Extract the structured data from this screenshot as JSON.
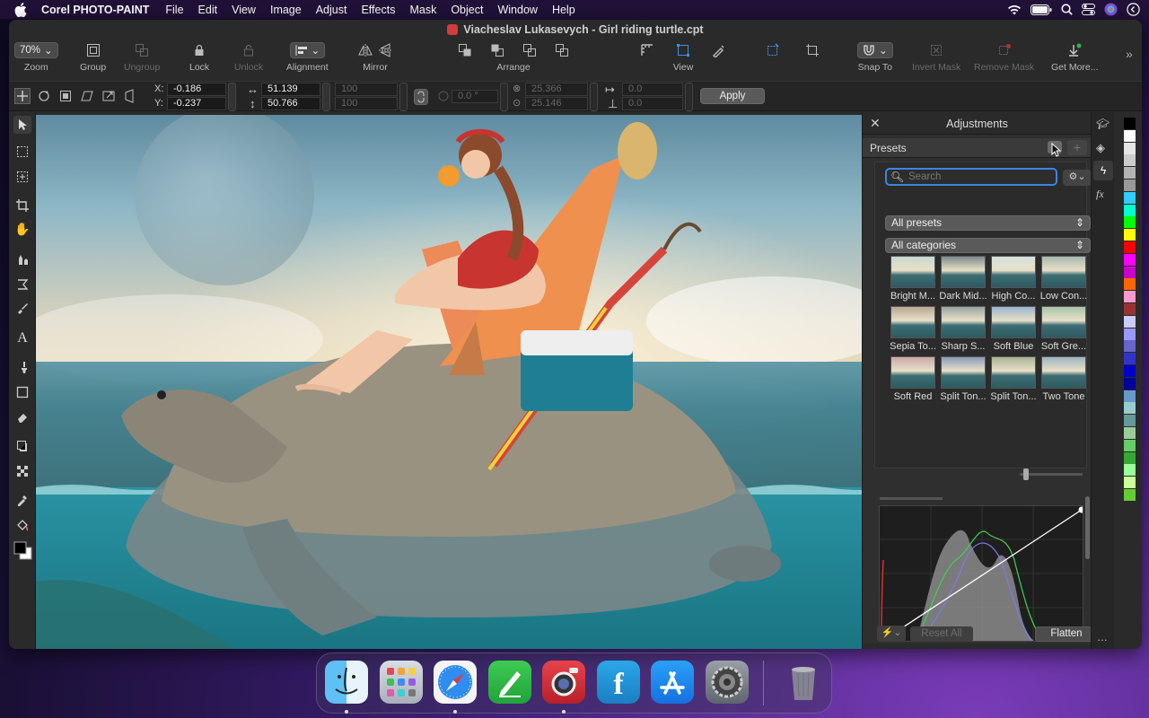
{
  "menubar": {
    "app_name": "Corel PHOTO-PAINT",
    "items": [
      "File",
      "Edit",
      "View",
      "Image",
      "Adjust",
      "Effects",
      "Mask",
      "Object",
      "Window",
      "Help"
    ]
  },
  "window": {
    "title": "Viacheslav Lukasevych - Girl riding turtle.cpt"
  },
  "toolbar": {
    "zoom_value": "70%",
    "zoom": "Zoom",
    "group": "Group",
    "ungroup": "Ungroup",
    "lock": "Lock",
    "unlock": "Unlock",
    "alignment": "Alignment",
    "mirror": "Mirror",
    "arrange": "Arrange",
    "view": "View",
    "snap_to": "Snap To",
    "invert_mask": "Invert Mask",
    "remove_mask": "Remove Mask",
    "get_more": "Get More..."
  },
  "propbar": {
    "x_label": "X:",
    "x_value": "-0.186",
    "y_label": "Y:",
    "y_value": "-0.237",
    "width_value": "51.139",
    "height_value": "50.766",
    "scale_w": "100",
    "scale_h": "100",
    "angle": "0.0 °",
    "rot_x": "25.366",
    "rot_y": "25.146",
    "skew_h": "0.0",
    "skew_v": "0.0",
    "apply": "Apply"
  },
  "docker": {
    "title": "Adjustments",
    "presets_label": "Presets",
    "search_placeholder": "Search",
    "filter1": "All presets",
    "filter2": "All categories",
    "presets": [
      "Bright M...",
      "Dark Mid...",
      "High Co...",
      "Low Con...",
      "Sepia To...",
      "Sharp S...",
      "Soft Blue",
      "Soft Gre...",
      "Soft Red",
      "Split Ton...",
      "Split Ton...",
      "Two Tone"
    ],
    "reset_all": "Reset All",
    "flatten": "Flatten"
  },
  "palette_colors": [
    "#000000",
    "#ffffff",
    "#e6e6e6",
    "#cccccc",
    "#b3b3b3",
    "#999999",
    "#33ccff",
    "#00ffcc",
    "#00ff00",
    "#ffff00",
    "#ff0000",
    "#ff00ff",
    "#cc00cc",
    "#ff6600",
    "#ff99cc",
    "#993333",
    "#ccccff",
    "#9999ff",
    "#6666cc",
    "#3333cc",
    "#0000cc",
    "#000099",
    "#6699cc",
    "#99cccc",
    "#669999",
    "#99cc99",
    "#66cc66",
    "#33aa33",
    "#99ff99",
    "#ccff99",
    "#66cc33"
  ],
  "dock": [
    "Finder",
    "Launchpad",
    "Safari",
    "Pages",
    "Photo Booth",
    "FontBase",
    "App Store",
    "System Preferences",
    "Trash"
  ]
}
